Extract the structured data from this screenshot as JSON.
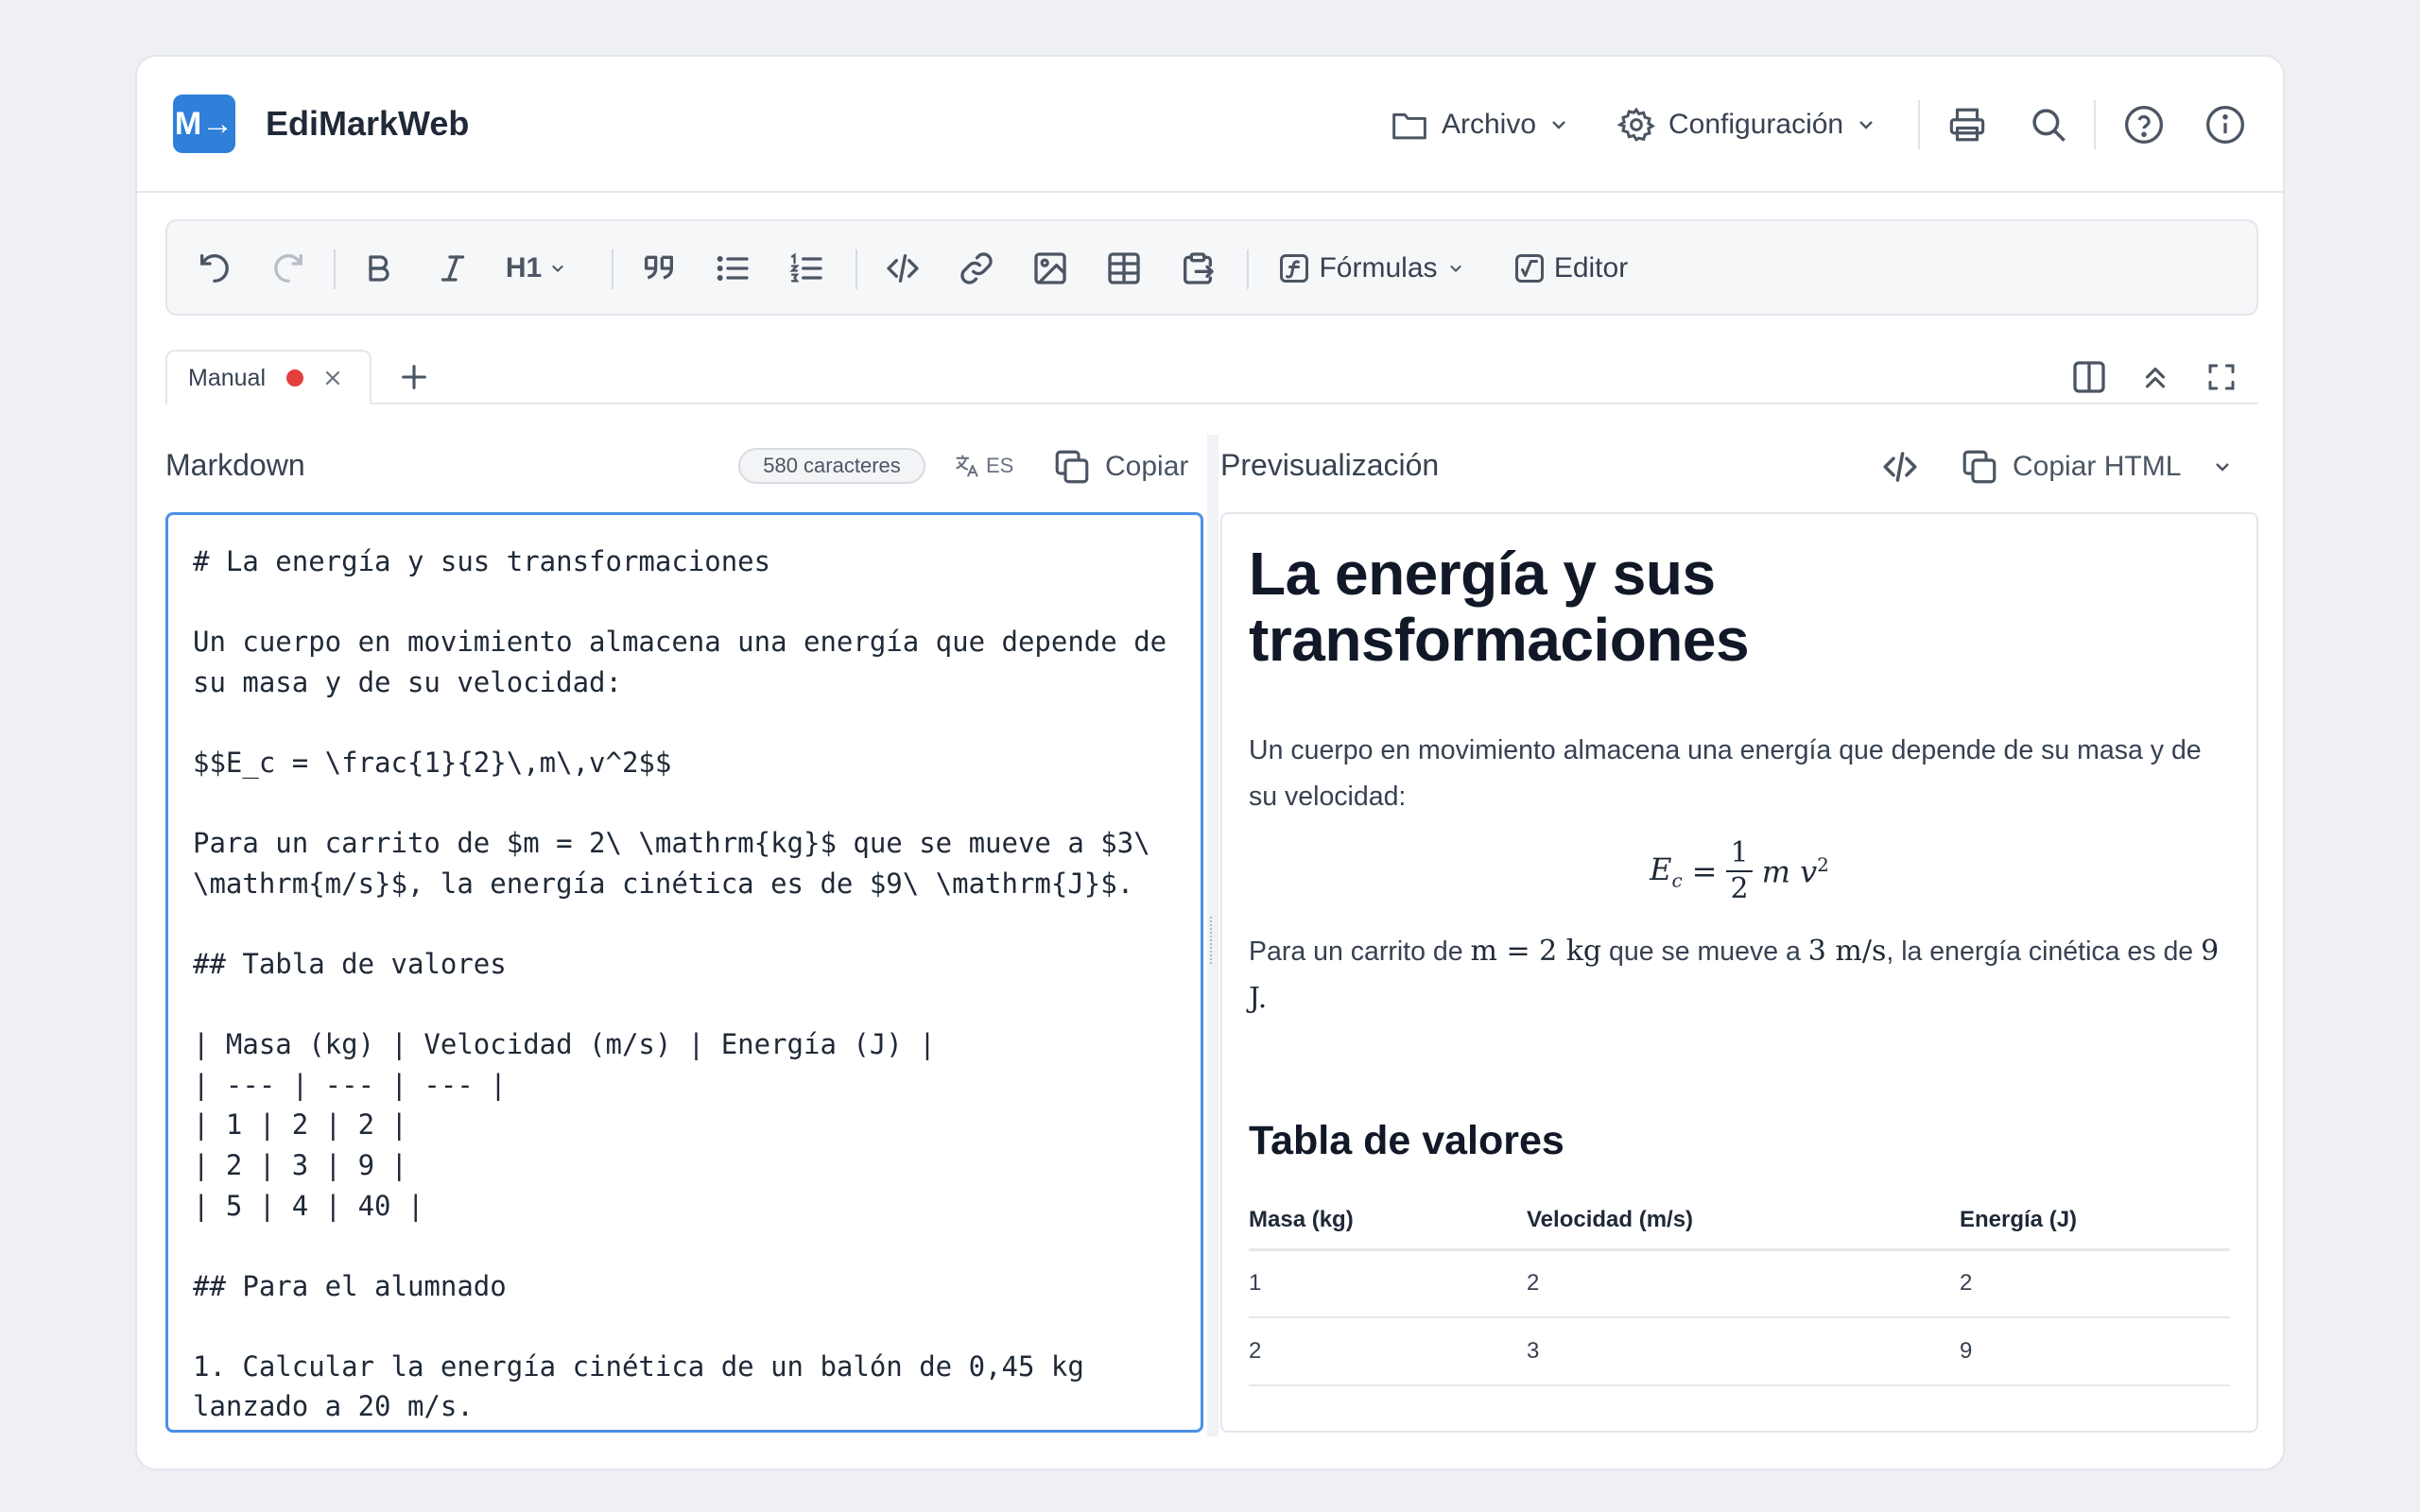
{
  "app": {
    "name": "EdiMarkWeb",
    "logo_text": "M→"
  },
  "header": {
    "archivo_label": "Archivo",
    "config_label": "Configuración"
  },
  "toolbar": {
    "heading_label": "H1",
    "formulas_label": "Fórmulas",
    "editor_label": "Editor"
  },
  "tabs": [
    {
      "label": "Manual",
      "unsaved_color": "#e53e3e"
    }
  ],
  "markdown_pane": {
    "title": "Markdown",
    "char_count": "580 caracteres",
    "language": "ES",
    "copy_label": "Copiar",
    "content": "# La energía y sus transformaciones\n\nUn cuerpo en movimiento almacena una energía que depende de su masa y de su velocidad:\n\n$$E_c = \\frac{1}{2}\\,m\\,v^2$$\n\nPara un carrito de $m = 2\\ \\mathrm{kg}$ que se mueve a $3\\ \\mathrm{m/s}$, la energía cinética es de $9\\ \\mathrm{J}$.\n\n## Tabla de valores\n\n| Masa (kg) | Velocidad (m/s) | Energía (J) |\n| --- | --- | --- |\n| 1 | 2 | 2 |\n| 2 | 3 | 9 |\n| 5 | 4 | 40 |\n\n## Para el alumnado\n\n1. Calcular la energía cinética de un balón de 0,45 kg lanzado a 20 m/s."
  },
  "preview_pane": {
    "title": "Previsualización",
    "copy_html_label": "Copiar HTML",
    "h1": "La energía y sus transformaciones",
    "p1": "Un cuerpo en movimiento almacena una energía que depende de su masa y de su velocidad:",
    "formula": {
      "lhs": "E",
      "sub": "c",
      "num": "1",
      "den": "2",
      "rhs_m": "m",
      "rhs_v": "v",
      "sup": "2"
    },
    "p2_a": "Para un carrito de ",
    "p2_m": "m = 2 kg",
    "p2_b": " que se mueve a ",
    "p2_v": "3 m/s",
    "p2_c": ", la energía cinética es de ",
    "p2_e": "9 J.",
    "h2": "Tabla de valores",
    "table": {
      "headers": [
        "Masa (kg)",
        "Velocidad (m/s)",
        "Energía (J)"
      ],
      "rows": [
        [
          "1",
          "2",
          "2"
        ],
        [
          "2",
          "3",
          "9"
        ]
      ]
    }
  },
  "colors": {
    "accent": "#2f80d8",
    "focus_border": "#4c8fe6",
    "unsaved_dot": "#e53e3e"
  }
}
